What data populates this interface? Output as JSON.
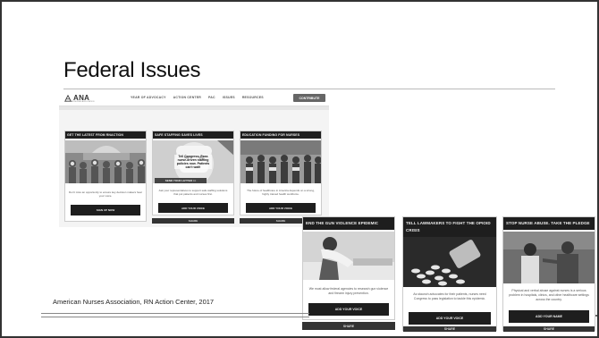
{
  "slide": {
    "title": "Federal Issues",
    "caption": "American Nurses Association, RN Action Center, 2017"
  },
  "site": {
    "logo_text": "ANA",
    "logo_sub": "AMERICAN NURSES ASSOCIATION",
    "nav": [
      "YEAR OF ADVOCACY",
      "ACTION CENTER",
      "PAC",
      "ISSUES",
      "RESOURCES"
    ],
    "contribute": "CONTRIBUTE"
  },
  "cards_top": [
    {
      "title": "GET THE LATEST FROM RNACTION",
      "text": "Don't miss an opportunity to ensure key decision makers hear your voice.",
      "button": "SIGN UP NOW"
    },
    {
      "title": "SAFE STAFFING SAVES LIVES",
      "overlay": "Tell Congress: Pass nurse-driven staffing policies now. Patients can't wait!",
      "overlay_btn": "SEND YOUR LETTER >>",
      "text": "Ask your representatives to support safe staffing solutions that put patients and nurses first.",
      "button": "ADD YOUR VOICE",
      "share": "SHARE"
    },
    {
      "title": "EDUCATION FUNDING FOR NURSES",
      "text": "The future of healthcare in America depends on a strong, highly trained health workforce.",
      "button": "ADD YOUR VOICE",
      "share": "SHARE"
    }
  ],
  "cards_bottom": [
    {
      "title": "END THE GUN VIOLENCE EPIDEMIC",
      "text": "We must allow federal agencies to research gun violence and firearm injury prevention.",
      "button": "ADD YOUR VOICE",
      "share": "SHARE"
    },
    {
      "title": "TELL LAWMAKERS TO FIGHT THE OPIOID CRISIS",
      "text": "As staunch advocates for their patients, nurses need Congress to pass legislation to tackle this epidemic.",
      "button": "ADD YOUR VOICE",
      "share": "SHARE"
    },
    {
      "title": "STOP NURSE ABUSE. TAKE THE PLEDGE",
      "text": "Physical and verbal abuse against nurses is a serious problem in hospitals, clinics, and other healthcare settings across the country.",
      "button": "ADD YOUR NAME",
      "share": "SHARE"
    }
  ]
}
